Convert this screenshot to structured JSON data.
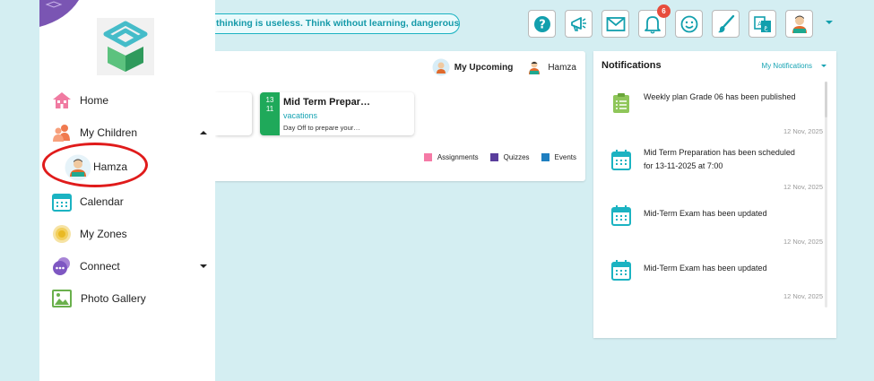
{
  "topbar": {
    "quote": "thinking is useless. Think without learning, dangerous – Confucius",
    "icons": [
      {
        "name": "help-icon"
      },
      {
        "name": "megaphone-icon"
      },
      {
        "name": "mail-icon"
      },
      {
        "name": "bell-icon",
        "badge": "6"
      },
      {
        "name": "smiley-icon"
      },
      {
        "name": "brush-icon"
      },
      {
        "name": "language-icon"
      },
      {
        "name": "user-avatar-icon"
      }
    ],
    "accent": "#129fad"
  },
  "sidebar": {
    "items": [
      {
        "label": "Home",
        "icon": "home-icon"
      },
      {
        "label": "My Children",
        "icon": "children-icon",
        "expanded": true
      },
      {
        "label": "Calendar",
        "icon": "calendar-icon"
      },
      {
        "label": "My Zones",
        "icon": "zones-icon"
      },
      {
        "label": "Connect",
        "icon": "connect-icon",
        "expanded": false
      },
      {
        "label": "Photo Gallery",
        "icon": "gallery-icon"
      }
    ],
    "child": {
      "name": "Hamza"
    }
  },
  "upcoming": {
    "header_label": "My Upcoming",
    "child_name": "Hamza",
    "event": {
      "date_day": "13",
      "date_month": "11",
      "title": "Mid Term Prepar…",
      "type": "vacations",
      "description": "Day Off to prepare your…"
    },
    "legend": [
      {
        "label": "Assignments",
        "color": "#f57aa6"
      },
      {
        "label": "Quizzes",
        "color": "#5a3e9c"
      },
      {
        "label": "Events",
        "color": "#1f7fc0"
      }
    ]
  },
  "notifications": {
    "title": "Notifications",
    "filter": "My Notifications",
    "items": [
      {
        "text": "Weekly plan Grade 06 has been published",
        "time": "12 Nov, 2025",
        "icon": "clipboard-icon"
      },
      {
        "text": "Mid Term Preparation has been scheduled for 13-11-2025 at 7:00",
        "time": "12 Nov, 2025",
        "icon": "calendar-icon"
      },
      {
        "text": "Mid-Term Exam has been updated",
        "time": "12 Nov, 2025",
        "icon": "calendar-icon"
      },
      {
        "text": "Mid-Term Exam has been updated",
        "time": "12 Nov, 2025",
        "icon": "calendar-icon"
      }
    ]
  }
}
